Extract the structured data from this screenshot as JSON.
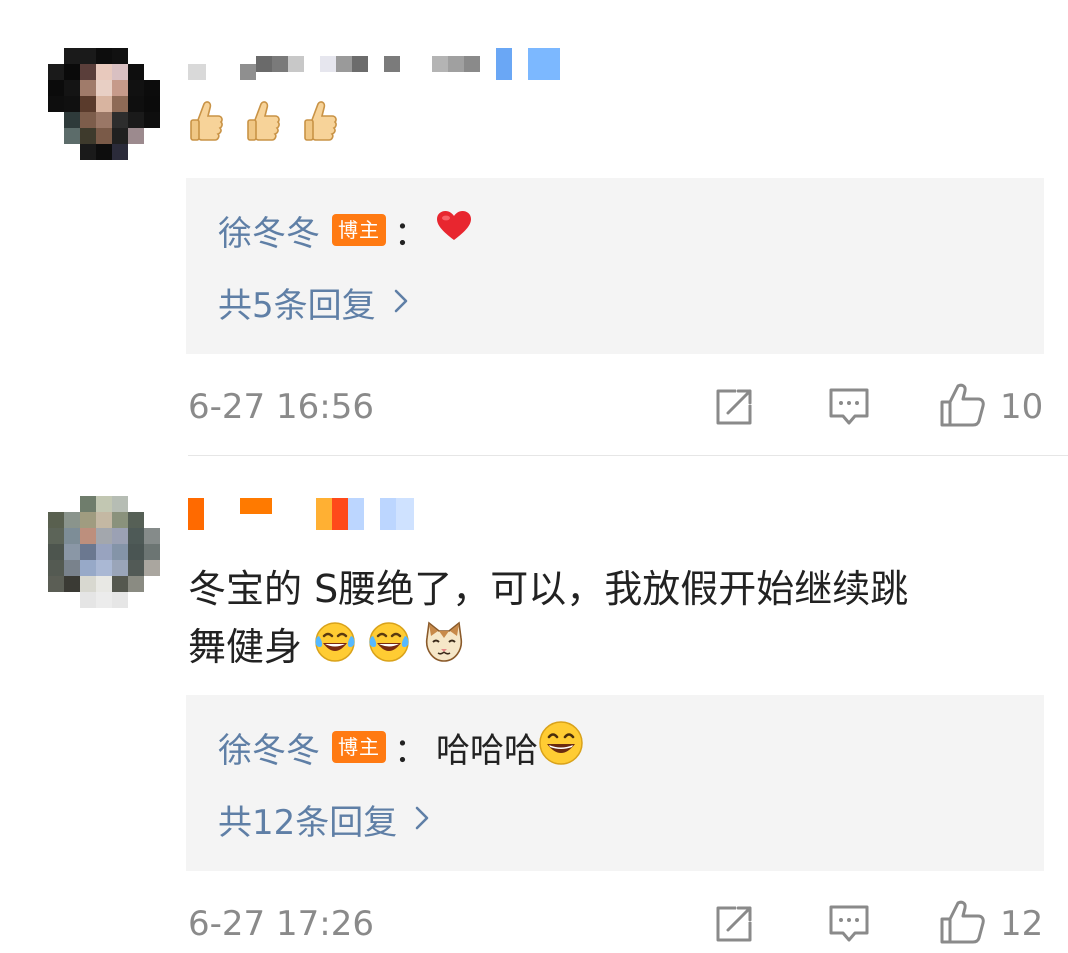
{
  "comments": [
    {
      "reply": {
        "author": "徐冬冬",
        "badge": "博主",
        "colon": "：",
        "text": "",
        "emoji": "heart-icon",
        "more_label": "共5条回复",
        "more_chevron": "›"
      },
      "comment_emojis": [
        "thumbs-up-icon",
        "thumbs-up-icon",
        "thumbs-up-icon"
      ],
      "timestamp": "6-27 16:56",
      "likes": "10"
    },
    {
      "text_line1": "冬宝的 S腰绝了，可以，我放假开始继续跳",
      "text_line2": "舞健身",
      "comment_emojis": [
        "laugh-cry-icon",
        "laugh-cry-icon",
        "cat-face-icon"
      ],
      "reply": {
        "author": "徐冬冬",
        "badge": "博主",
        "colon": "：",
        "text": "哈哈哈",
        "emoji": "grin-icon",
        "more_label": "共12条回复",
        "more_chevron": "›"
      },
      "timestamp": "6-27 17:26",
      "likes": "12"
    }
  ],
  "colors": {
    "link": "#5f7fa6",
    "badge": "#ff7a12",
    "reply_bg": "#f4f4f4",
    "meta": "#8a8a8a"
  }
}
